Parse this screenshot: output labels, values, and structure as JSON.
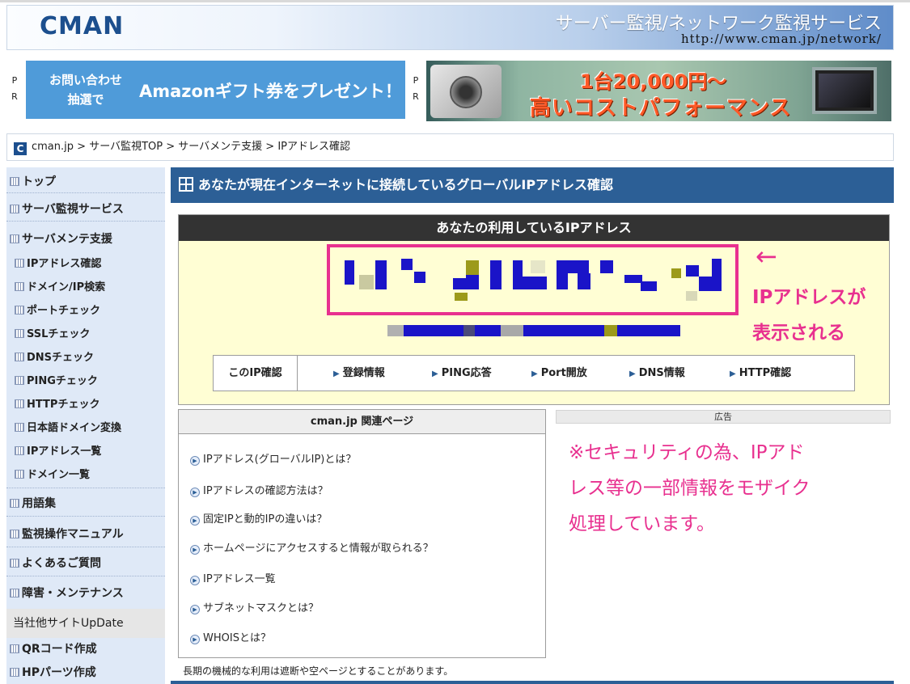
{
  "header": {
    "logo": "CMAN",
    "tagline": "サーバー監視/ネットワーク監視サービス",
    "url": "http://www.cman.jp/network/"
  },
  "pr": {
    "mark": [
      "P",
      "R"
    ],
    "banner1": {
      "line1": "お問い合わせ",
      "line2": "抽選で",
      "main": "Amazonギフト券をプレゼント！"
    },
    "banner2": {
      "line1": "1台20,000円〜",
      "line2": "高いコストパフォーマンス"
    }
  },
  "breadcrumb": {
    "logo_char": "C",
    "items": [
      "cman.jp",
      "サーバ監視TOP",
      "サーバメンテ支援",
      "IPアドレス確認"
    ],
    "separator": ">"
  },
  "sidebar": {
    "items": [
      {
        "label": "トップ",
        "sub": false
      },
      {
        "label": "サーバ監視サービス",
        "sub": false
      },
      {
        "label": "サーバメンテ支援",
        "sub": false
      },
      {
        "label": "IPアドレス確認",
        "sub": true
      },
      {
        "label": "ドメイン/IP検索",
        "sub": true
      },
      {
        "label": "ポートチェック",
        "sub": true
      },
      {
        "label": "SSLチェック",
        "sub": true
      },
      {
        "label": "DNSチェック",
        "sub": true
      },
      {
        "label": "PINGチェック",
        "sub": true
      },
      {
        "label": "HTTPチェック",
        "sub": true
      },
      {
        "label": "日本語ドメイン変換",
        "sub": true
      },
      {
        "label": "IPアドレス一覧",
        "sub": true
      },
      {
        "label": "ドメイン一覧",
        "sub": true
      },
      {
        "label": "用語集",
        "sub": false
      },
      {
        "label": "監視操作マニュアル",
        "sub": false
      },
      {
        "label": "よくあるご質問",
        "sub": false
      },
      {
        "label": "障害・メンテナンス",
        "sub": false
      }
    ],
    "other_sites_label": "当社他サイトUpDate",
    "other_sites": [
      "QRコード作成",
      "HPパーツ作成"
    ]
  },
  "main": {
    "title": "あなたが現在インターネットに接続しているグローバルIPアドレス確認",
    "ip_header": "あなたの利用しているIPアドレス",
    "ip_links_label": "このIP確認",
    "ip_links": [
      "登録情報",
      "PING応答",
      "Port開放",
      "DNS情報",
      "HTTP確認"
    ]
  },
  "annotations": {
    "arrow": "←",
    "ip_note_line1": "IPアドレスが",
    "ip_note_line2": "表示される",
    "security_note_line1": "※セキュリティの為、IPアド",
    "security_note_line2": "レス等の一部情報をモザイク",
    "security_note_line3": "処理しています。"
  },
  "related": {
    "title": "cman.jp 関連ページ",
    "items": [
      "IPアドレス(グローバルIP)とは？",
      "IPアドレスの確認方法は？",
      "固定IPと動的IPの違いは？",
      "ホームページにアクセスすると情報が取られる？",
      "IPアドレス一覧",
      "サブネットマスクとは？",
      "WHOISとは？"
    ]
  },
  "ad_label": "広告",
  "footer_note": "長期の機械的な利用は遮断や空ページとすることがあります。",
  "colors": {
    "brand_blue": "#2c5f96",
    "annotation_pink": "#e8308f",
    "ip_box_bg": "#fffed4",
    "sidebar_bg": "#dfe9f7",
    "mosaic_blue": "#1a14c8",
    "mosaic_olive": "#9c9a1a"
  },
  "icons": {
    "sidebar_bullet": "grid-square-icon",
    "title_icon": "grid-icon",
    "link_marker": "triangle-right-icon",
    "related_bullet": "circle-play-icon"
  }
}
